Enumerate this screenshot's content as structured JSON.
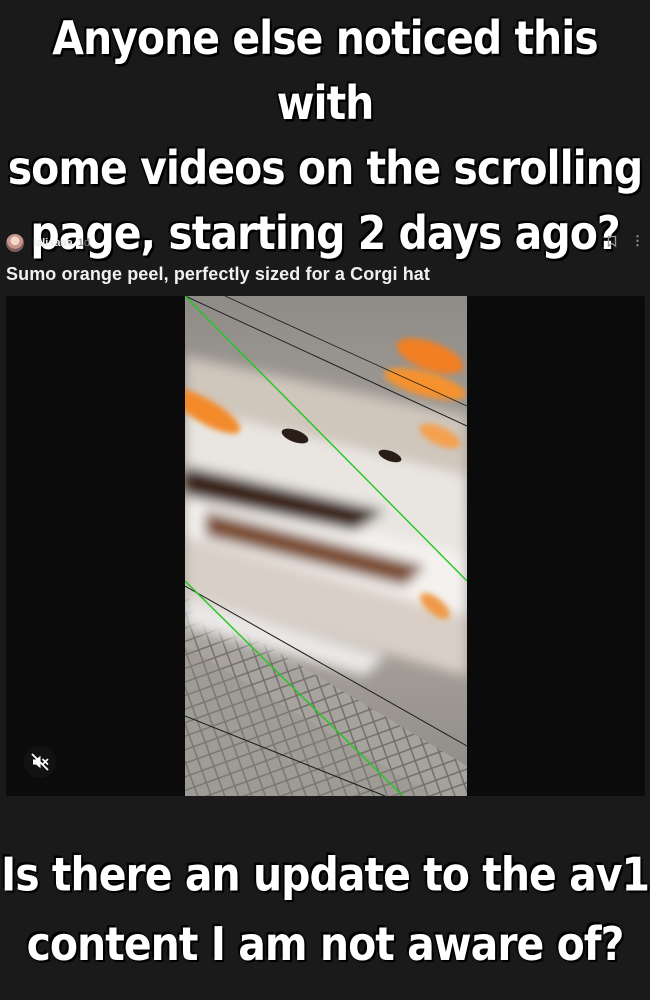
{
  "meme": {
    "top_caption": "Anyone else noticed this with\nsome videos on the scrolling\npage, starting 2 days ago?",
    "bottom_caption": "Is there an update to the av1\ncontent I am not aware of?"
  },
  "post": {
    "username": "lalisaaa",
    "time": "1d",
    "title": "Sumo orange peel, perfectly sized for a Corgi hat",
    "icons": {
      "avatar": "user-avatar",
      "bookmark": "bookmark-icon",
      "more": "more-vertical-icon",
      "mute": "speaker-muted-icon"
    },
    "more_glyph": "⋮"
  },
  "colors": {
    "background": "#1a1a1b",
    "video_background": "#0b0b0b",
    "artifact_line": "#22c81e"
  }
}
